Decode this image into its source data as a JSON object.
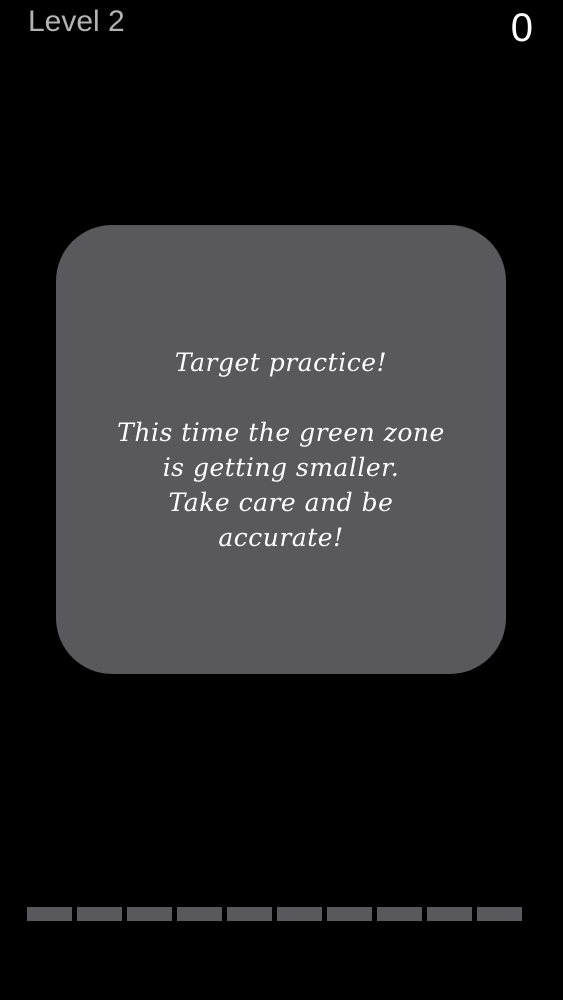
{
  "hud": {
    "level_label": "Level 2",
    "score": "0"
  },
  "message": {
    "title": "Target practice!",
    "lines": [
      "This time the green zone",
      "is getting smaller.",
      "Take care and be",
      "accurate!"
    ]
  },
  "progress": {
    "segments_total": 10,
    "segments_filled": 0,
    "color": "#59585b"
  },
  "colors": {
    "background": "#000000",
    "card": "#59585b",
    "level_text": "#b3b3b3",
    "score_text": "#ffffff",
    "message_text": "#ffffff"
  }
}
